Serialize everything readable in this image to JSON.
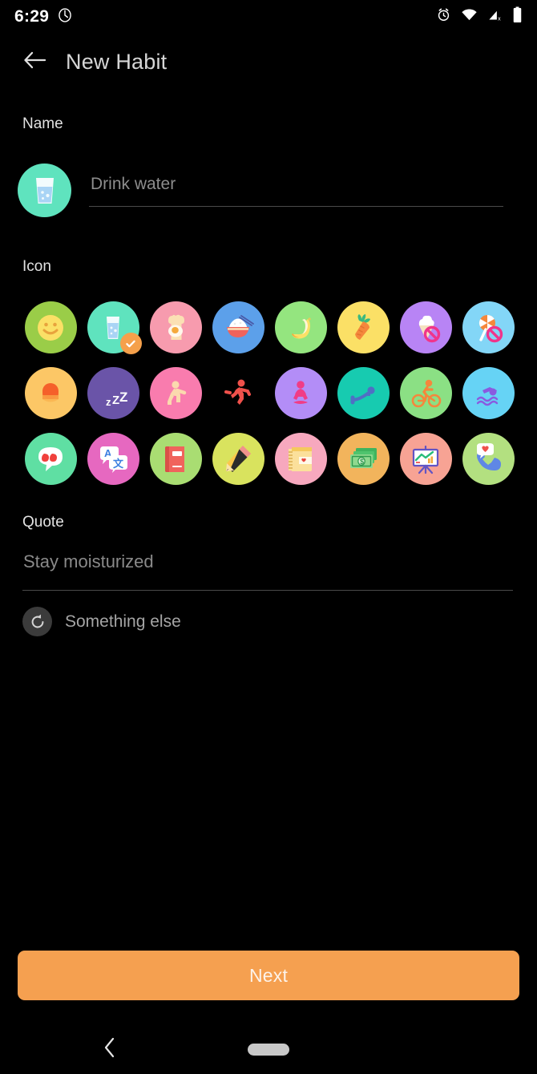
{
  "status_bar": {
    "time": "6:29",
    "left_icons": [
      "phone-rotate-icon"
    ],
    "right_icons": [
      "alarm-icon",
      "wifi-icon",
      "cell-signal-off-icon",
      "battery-icon"
    ]
  },
  "app_bar": {
    "back_icon": "arrow-left-icon",
    "title": "New Habit"
  },
  "name_section": {
    "label": "Name",
    "avatar_icon": "water-glass-icon",
    "avatar_color": "#5FE3BE",
    "input_value": "",
    "input_placeholder": "Drink water"
  },
  "icon_section": {
    "label": "Icon",
    "selected_index": 1,
    "check_badge_color": "#F5A04B",
    "icons": [
      {
        "name": "smiley-face-icon",
        "bg": "#9ACD48"
      },
      {
        "name": "water-glass-icon",
        "bg": "#5FE3BE"
      },
      {
        "name": "egg-toast-icon",
        "bg": "#F79BAE"
      },
      {
        "name": "rice-bowl-icon",
        "bg": "#5CA0EA"
      },
      {
        "name": "banana-icon",
        "bg": "#94E57F"
      },
      {
        "name": "carrot-icon",
        "bg": "#FBE066"
      },
      {
        "name": "no-ice-cream-icon",
        "bg": "#B884F5"
      },
      {
        "name": "no-lollipop-icon",
        "bg": "#83D6F7"
      },
      {
        "name": "sunrise-icon",
        "bg": "#FCC766"
      },
      {
        "name": "sleep-moon-icon",
        "bg": "#6A54A8"
      },
      {
        "name": "stretching-icon",
        "bg": "#F97CAE"
      },
      {
        "name": "running-icon",
        "bg": "#F6A council"
      },
      {
        "name": "yoga-icon",
        "bg": "#B38DF7"
      },
      {
        "name": "plank-exercise-icon",
        "bg": "#17CBB0"
      },
      {
        "name": "cycling-icon",
        "bg": "#8BE084"
      },
      {
        "name": "swimming-icon",
        "bg": "#66D3F5"
      },
      {
        "name": "quote-bubble-icon",
        "bg": "#5FDFA3"
      },
      {
        "name": "translate-icon",
        "bg": "#E668C0"
      },
      {
        "name": "book-icon",
        "bg": "#A9DD72"
      },
      {
        "name": "pencil-icon",
        "bg": "#D9E35E"
      },
      {
        "name": "diary-icon",
        "bg": "#F7A8BE"
      },
      {
        "name": "money-icon",
        "bg": "#F2B45C"
      },
      {
        "name": "presentation-icon",
        "bg": "#F7A394"
      },
      {
        "name": "call-heart-icon",
        "bg": "#B3E080"
      }
    ]
  },
  "quote_section": {
    "label": "Quote",
    "input_value": "",
    "input_placeholder": "Stay moisturized",
    "refresh_icon": "refresh-icon",
    "refresh_label": "Something else"
  },
  "footer": {
    "next_label": "Next",
    "next_color": "#F5A050"
  },
  "nav_bar": {
    "back_icon": "chevron-left-icon",
    "home_handle": "home-pill"
  }
}
